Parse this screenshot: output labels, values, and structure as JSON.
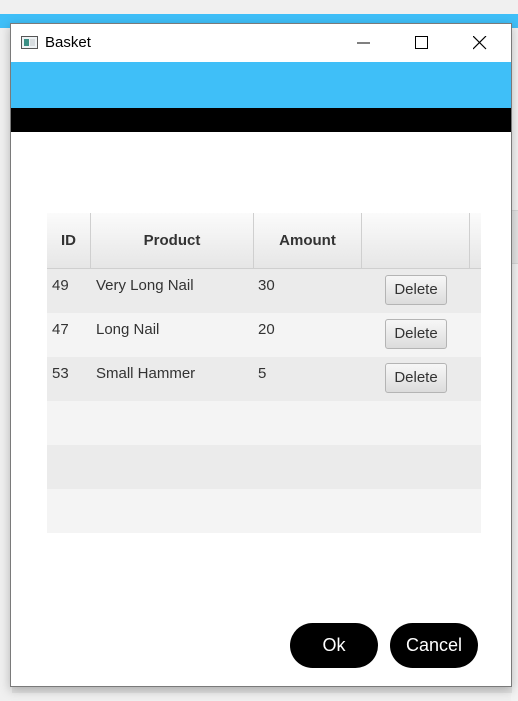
{
  "window": {
    "title": "Basket",
    "minimize_icon": "minimize-icon",
    "maximize_icon": "maximize-icon",
    "close_icon": "close-icon",
    "accent_color": "#3fbff8"
  },
  "table": {
    "columns": [
      "ID",
      "Product",
      "Amount",
      ""
    ],
    "rows": [
      {
        "id": "49",
        "product": "Very Long Nail",
        "amount": "30",
        "action": "Delete"
      },
      {
        "id": "47",
        "product": "Long Nail",
        "amount": "20",
        "action": "Delete"
      },
      {
        "id": "53",
        "product": "Small Hammer",
        "amount": "5",
        "action": "Delete"
      }
    ]
  },
  "actions": {
    "ok_label": "Ok",
    "cancel_label": "Cancel"
  }
}
